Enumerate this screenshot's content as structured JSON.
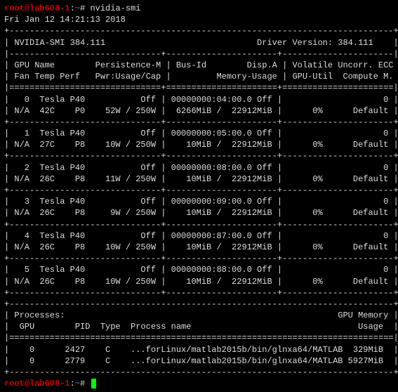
{
  "prompt": {
    "user": "root",
    "host": "lab608-1",
    "path": "~",
    "sym": "#"
  },
  "command": "nvidia-smi",
  "timestamp": "Fri Jan 12 14:21:13 2018",
  "smi_version_label": "NVIDIA-SMI",
  "smi_version": "384.111",
  "driver_label": "Driver Version:",
  "driver_version": "384.111",
  "headers": {
    "row1": {
      "gpu": "GPU",
      "name": "Name",
      "persist": "Persistence-M",
      "busid": "Bus-Id",
      "dispa": "Disp.A",
      "vol": "Volatile",
      "ecc": "Uncorr. ECC"
    },
    "row2": {
      "fan": "Fan",
      "temp": "Temp",
      "perf": "Perf",
      "pwr": "Pwr:Usage/Cap",
      "mem": "Memory-Usage",
      "gpuutil": "GPU-Util",
      "compute": "Compute M."
    }
  },
  "gpus": [
    {
      "index": "0",
      "name": "Tesla P40",
      "persist": "Off",
      "fan": "N/A",
      "temp": "42C",
      "perf": "P0",
      "pwr": "52W / 250W",
      "busid": "00000000:04:00.0",
      "dispa": "Off",
      "memused": "6266MiB",
      "memtotal": "22912MiB",
      "gpuutil": "0%",
      "ecc": "0",
      "compute": "Default"
    },
    {
      "index": "1",
      "name": "Tesla P40",
      "persist": "Off",
      "fan": "N/A",
      "temp": "27C",
      "perf": "P8",
      "pwr": "10W / 250W",
      "busid": "00000000:05:00.0",
      "dispa": "Off",
      "memused": "10MiB",
      "memtotal": "22912MiB",
      "gpuutil": "0%",
      "ecc": "0",
      "compute": "Default"
    },
    {
      "index": "2",
      "name": "Tesla P40",
      "persist": "Off",
      "fan": "N/A",
      "temp": "26C",
      "perf": "P8",
      "pwr": "11W / 250W",
      "busid": "00000000:08:00.0",
      "dispa": "Off",
      "memused": "10MiB",
      "memtotal": "22912MiB",
      "gpuutil": "0%",
      "ecc": "0",
      "compute": "Default"
    },
    {
      "index": "3",
      "name": "Tesla P40",
      "persist": "Off",
      "fan": "N/A",
      "temp": "26C",
      "perf": "P8",
      "pwr": "9W / 250W",
      "busid": "00000000:09:00.0",
      "dispa": "Off",
      "memused": "10MiB",
      "memtotal": "22912MiB",
      "gpuutil": "0%",
      "ecc": "0",
      "compute": "Default"
    },
    {
      "index": "4",
      "name": "Tesla P40",
      "persist": "Off",
      "fan": "N/A",
      "temp": "26C",
      "perf": "P8",
      "pwr": "10W / 250W",
      "busid": "00000000:87:00.0",
      "dispa": "Off",
      "memused": "10MiB",
      "memtotal": "22912MiB",
      "gpuutil": "0%",
      "ecc": "0",
      "compute": "Default"
    },
    {
      "index": "5",
      "name": "Tesla P40",
      "persist": "Off",
      "fan": "N/A",
      "temp": "26C",
      "perf": "P8",
      "pwr": "10W / 250W",
      "busid": "00000000:88:00.0",
      "dispa": "Off",
      "memused": "10MiB",
      "memtotal": "22912MiB",
      "gpuutil": "0%",
      "ecc": "0",
      "compute": "Default"
    }
  ],
  "proc_section": {
    "title": "Processes:",
    "mem_label": "GPU Memory",
    "headers": {
      "gpu": "GPU",
      "pid": "PID",
      "type": "Type",
      "name": "Process name",
      "usage": "Usage"
    }
  },
  "processes": [
    {
      "gpu": "0",
      "pid": "2427",
      "type": "C",
      "name": "...forLinux/matlab2015b/bin/glnxa64/MATLAB",
      "mem": "329MiB"
    },
    {
      "gpu": "0",
      "pid": "2779",
      "type": "C",
      "name": "...forLinux/matlab2015b/bin/glnxa64/MATLAB",
      "mem": "5927MiB"
    }
  ]
}
